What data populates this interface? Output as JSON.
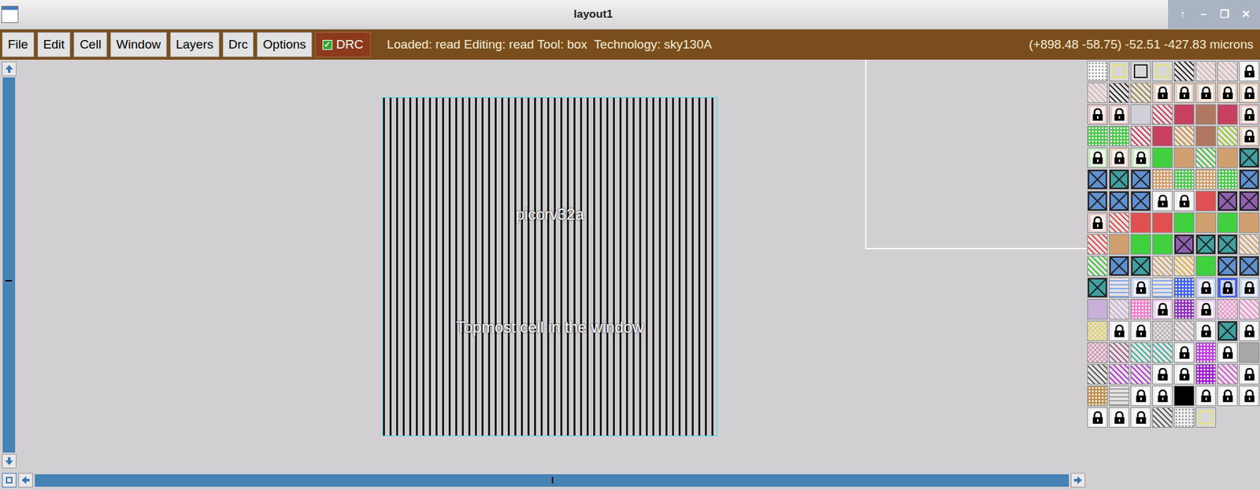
{
  "window": {
    "title": "layout1",
    "controls": [
      "↑",
      "–",
      "❐",
      "✕"
    ]
  },
  "menu": [
    "File",
    "Edit",
    "Cell",
    "Window",
    "Layers",
    "Drc",
    "Options"
  ],
  "drc_toggle": {
    "label": "DRC",
    "checked": true
  },
  "status": {
    "text": "Loaded: read Editing: read Tool: box  Technology: sky130A",
    "coords": "(+898.48 -58.75) -52.51 -427.83 microns"
  },
  "layout": {
    "cell_name": "picorv32a",
    "cell_caption": "Topmost cell in the window"
  },
  "scrollbars": {
    "vertical": {
      "level": 0.54
    },
    "horizontal": {
      "level": 0.5
    }
  },
  "palette": [
    {
      "kind": "dots",
      "color": "#ffffff"
    },
    {
      "kind": "outline",
      "color": "#e8e070"
    },
    {
      "kind": "outline",
      "color": "#202020"
    },
    {
      "kind": "outline",
      "color": "#e8e070"
    },
    {
      "kind": "hatch",
      "color": "#303030"
    },
    {
      "kind": "hatch",
      "color": "#d8b8b8"
    },
    {
      "kind": "hatch",
      "color": "#d8b8b8"
    },
    {
      "kind": "lock",
      "color": "#f0f0f0"
    },
    {
      "kind": "hatch",
      "color": "#d8b8b8"
    },
    {
      "kind": "hatch",
      "color": "#303030"
    },
    {
      "kind": "hatch",
      "color": "#9a8a50"
    },
    {
      "kind": "lock",
      "color": "#e8d0c0"
    },
    {
      "kind": "lock",
      "color": "#e8d0c0"
    },
    {
      "kind": "lock",
      "color": "#e8d0c0"
    },
    {
      "kind": "lock",
      "color": "#e8d0c0"
    },
    {
      "kind": "lock",
      "color": "#e8d0c0"
    },
    {
      "kind": "lock",
      "color": "#e8c8c8"
    },
    {
      "kind": "lock",
      "color": "#e8c8c8"
    },
    {
      "kind": "solid",
      "color": "#d0d0d8"
    },
    {
      "kind": "hatch",
      "color": "#c84060"
    },
    {
      "kind": "solid",
      "color": "#c84060"
    },
    {
      "kind": "solid",
      "color": "#b07860"
    },
    {
      "kind": "solid",
      "color": "#c84060"
    },
    {
      "kind": "lock",
      "color": "#e8c8c8"
    },
    {
      "kind": "dots",
      "color": "#50c850"
    },
    {
      "kind": "dots",
      "color": "#50c850"
    },
    {
      "kind": "hatch",
      "color": "#c84060"
    },
    {
      "kind": "solid",
      "color": "#c84060"
    },
    {
      "kind": "hatch",
      "color": "#c89040"
    },
    {
      "kind": "solid",
      "color": "#b07860"
    },
    {
      "kind": "hatch",
      "color": "#90c830"
    },
    {
      "kind": "lock",
      "color": "#e8d0c0"
    },
    {
      "kind": "lock",
      "color": "#c8e8c0"
    },
    {
      "kind": "lock",
      "color": "#e8d0c0"
    },
    {
      "kind": "lock",
      "color": "#c8e8c0"
    },
    {
      "kind": "solid",
      "color": "#40d040"
    },
    {
      "kind": "solid",
      "color": "#d0a070"
    },
    {
      "kind": "hatch",
      "color": "#40c040"
    },
    {
      "kind": "solid",
      "color": "#d0a070"
    },
    {
      "kind": "cross",
      "color": "#40a0a0"
    },
    {
      "kind": "cross",
      "color": "#6090d0"
    },
    {
      "kind": "cross",
      "color": "#40a0a0"
    },
    {
      "kind": "cross",
      "color": "#6090d0"
    },
    {
      "kind": "dots",
      "color": "#d0a070"
    },
    {
      "kind": "dots",
      "color": "#50c850"
    },
    {
      "kind": "dots",
      "color": "#d0a070"
    },
    {
      "kind": "dots",
      "color": "#50c850"
    },
    {
      "kind": "cross",
      "color": "#6090d0"
    },
    {
      "kind": "cross",
      "color": "#6090d0"
    },
    {
      "kind": "cross",
      "color": "#6090d0"
    },
    {
      "kind": "cross",
      "color": "#6090d0"
    },
    {
      "kind": "lock",
      "color": "#f0f0f0"
    },
    {
      "kind": "lock",
      "color": "#f0f0f0"
    },
    {
      "kind": "solid",
      "color": "#e05050"
    },
    {
      "kind": "cross",
      "color": "#9060b0"
    },
    {
      "kind": "cross",
      "color": "#9060b0"
    },
    {
      "kind": "lock",
      "color": "#e8c8c8"
    },
    {
      "kind": "hatch",
      "color": "#e05050"
    },
    {
      "kind": "solid",
      "color": "#e05050"
    },
    {
      "kind": "solid",
      "color": "#e05050"
    },
    {
      "kind": "solid",
      "color": "#40d040"
    },
    {
      "kind": "solid",
      "color": "#d0a070"
    },
    {
      "kind": "solid",
      "color": "#40d040"
    },
    {
      "kind": "solid",
      "color": "#d0a070"
    },
    {
      "kind": "hatch",
      "color": "#e05050"
    },
    {
      "kind": "solid",
      "color": "#d0a070"
    },
    {
      "kind": "solid",
      "color": "#40d040"
    },
    {
      "kind": "solid",
      "color": "#40d040"
    },
    {
      "kind": "cross",
      "color": "#9060b0"
    },
    {
      "kind": "cross",
      "color": "#40a0a0"
    },
    {
      "kind": "cross",
      "color": "#40a0a0"
    },
    {
      "kind": "hatch",
      "color": "#d0a070"
    },
    {
      "kind": "hatch",
      "color": "#40c040"
    },
    {
      "kind": "cross",
      "color": "#6090d0"
    },
    {
      "kind": "cross",
      "color": "#40a0a0"
    },
    {
      "kind": "hatch",
      "color": "#d0a070"
    },
    {
      "kind": "hatch",
      "color": "#e0b040"
    },
    {
      "kind": "solid",
      "color": "#40d040"
    },
    {
      "kind": "cross",
      "color": "#6090d0"
    },
    {
      "kind": "cross",
      "color": "#6090d0"
    },
    {
      "kind": "cross",
      "color": "#40a0a0"
    },
    {
      "kind": "waves",
      "color": "#80a8f0"
    },
    {
      "kind": "lock",
      "color": "#c8d8f8"
    },
    {
      "kind": "waves",
      "color": "#80a8f0"
    },
    {
      "kind": "dots",
      "color": "#4060f0"
    },
    {
      "kind": "lock",
      "color": "#c8d8f8"
    },
    {
      "kind": "lock",
      "color": "#4060f0"
    },
    {
      "kind": "lock",
      "color": "#c8d8f8"
    },
    {
      "kind": "solid",
      "color": "#c8b0d8"
    },
    {
      "kind": "hatch",
      "color": "#c8b0d8"
    },
    {
      "kind": "dots",
      "color": "#f080d0"
    },
    {
      "kind": "lock",
      "color": "#f0d0f0"
    },
    {
      "kind": "dots",
      "color": "#9030c0"
    },
    {
      "kind": "lock",
      "color": "#f0d0f0"
    },
    {
      "kind": "crosshatch",
      "color": "#f090d0"
    },
    {
      "kind": "hatch",
      "color": "#f090d0"
    },
    {
      "kind": "crosshatch",
      "color": "#e0d060"
    },
    {
      "kind": "lock",
      "color": "#f0f0f0"
    },
    {
      "kind": "lock",
      "color": "#f0f0f0"
    },
    {
      "kind": "crosshatch",
      "color": "#b8b0b0"
    },
    {
      "kind": "hatch",
      "color": "#b8a8a8"
    },
    {
      "kind": "lock",
      "color": "#f0f0f0"
    },
    {
      "kind": "cross",
      "color": "#40a0a0"
    },
    {
      "kind": "lock",
      "color": "#f0f0f0"
    },
    {
      "kind": "crosshatch",
      "color": "#d890b0"
    },
    {
      "kind": "hatch",
      "color": "#a06090"
    },
    {
      "kind": "hatch",
      "color": "#40b0a0"
    },
    {
      "kind": "hatch",
      "color": "#40b0a0"
    },
    {
      "kind": "lock",
      "color": "#f0f0f0"
    },
    {
      "kind": "dots",
      "color": "#c040e0"
    },
    {
      "kind": "lock",
      "color": "#f0f0f0"
    },
    {
      "kind": "solid",
      "color": "#a8a8a8"
    },
    {
      "kind": "hatch",
      "color": "#606060"
    },
    {
      "kind": "hatch",
      "color": "#b040d0"
    },
    {
      "kind": "hatch",
      "color": "#b040d0"
    },
    {
      "kind": "lock",
      "color": "#f0f0f0"
    },
    {
      "kind": "lock",
      "color": "#f0f0f0"
    },
    {
      "kind": "dots",
      "color": "#a020d0"
    },
    {
      "kind": "hatch",
      "color": "#d060d0"
    },
    {
      "kind": "lock",
      "color": "#f0f0f0"
    },
    {
      "kind": "dots",
      "color": "#c09050"
    },
    {
      "kind": "waves",
      "color": "#a0a0a0"
    },
    {
      "kind": "lock",
      "color": "#f0f0f0"
    },
    {
      "kind": "lock",
      "color": "#f0f0f0"
    },
    {
      "kind": "solid",
      "color": "#000000"
    },
    {
      "kind": "lock",
      "color": "#f0f0f0"
    },
    {
      "kind": "lock",
      "color": "#f0f0f0"
    },
    {
      "kind": "lock",
      "color": "#f0f0f0"
    },
    {
      "kind": "lock",
      "color": "#f0f0f0"
    },
    {
      "kind": "lock",
      "color": "#f0f0f0"
    },
    {
      "kind": "lock",
      "color": "#f0f0f0"
    },
    {
      "kind": "hatch",
      "color": "#606060"
    },
    {
      "kind": "dots",
      "color": "#f0f0f0"
    },
    {
      "kind": "outline",
      "color": "#e8e070"
    }
  ]
}
